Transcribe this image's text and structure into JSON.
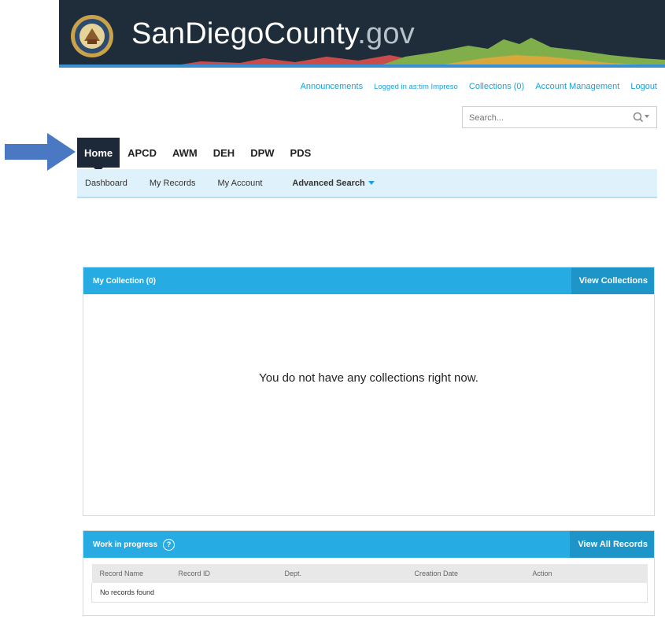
{
  "header": {
    "title_main": "SanDiegoCounty",
    "title_domain": ".gov"
  },
  "utility_nav": {
    "announcements": "Announcements",
    "logged_in": "Logged in as:tim Impreso",
    "collections": "Collections (0)",
    "account_management": "Account Management",
    "logout": "Logout"
  },
  "search": {
    "placeholder": "Search..."
  },
  "main_nav": {
    "items": [
      "Home",
      "APCD",
      "AWM",
      "DEH",
      "DPW",
      "PDS"
    ],
    "active": "Home"
  },
  "sub_nav": {
    "items": [
      "Dashboard",
      "My Records",
      "My Account"
    ],
    "advanced": "Advanced Search"
  },
  "collection_panel": {
    "title": "My Collection (0)",
    "action": "View Collections",
    "empty_message": "You do not have any collections right now."
  },
  "wip_panel": {
    "title": "Work in progress",
    "action": "View All Records",
    "columns": [
      "Record Name",
      "Record ID",
      "Dept.",
      "Creation Date",
      "Action"
    ],
    "empty_message": "No records found"
  },
  "icons": {
    "seal": "county-seal-icon",
    "search": "search-icon",
    "arrow": "arrow-right-icon",
    "help": "question-circle-icon"
  },
  "colors": {
    "accent": "#27abe3",
    "nav_active": "#1d2938",
    "banner": "#1f2d3a",
    "arrow": "#4a78c2"
  }
}
